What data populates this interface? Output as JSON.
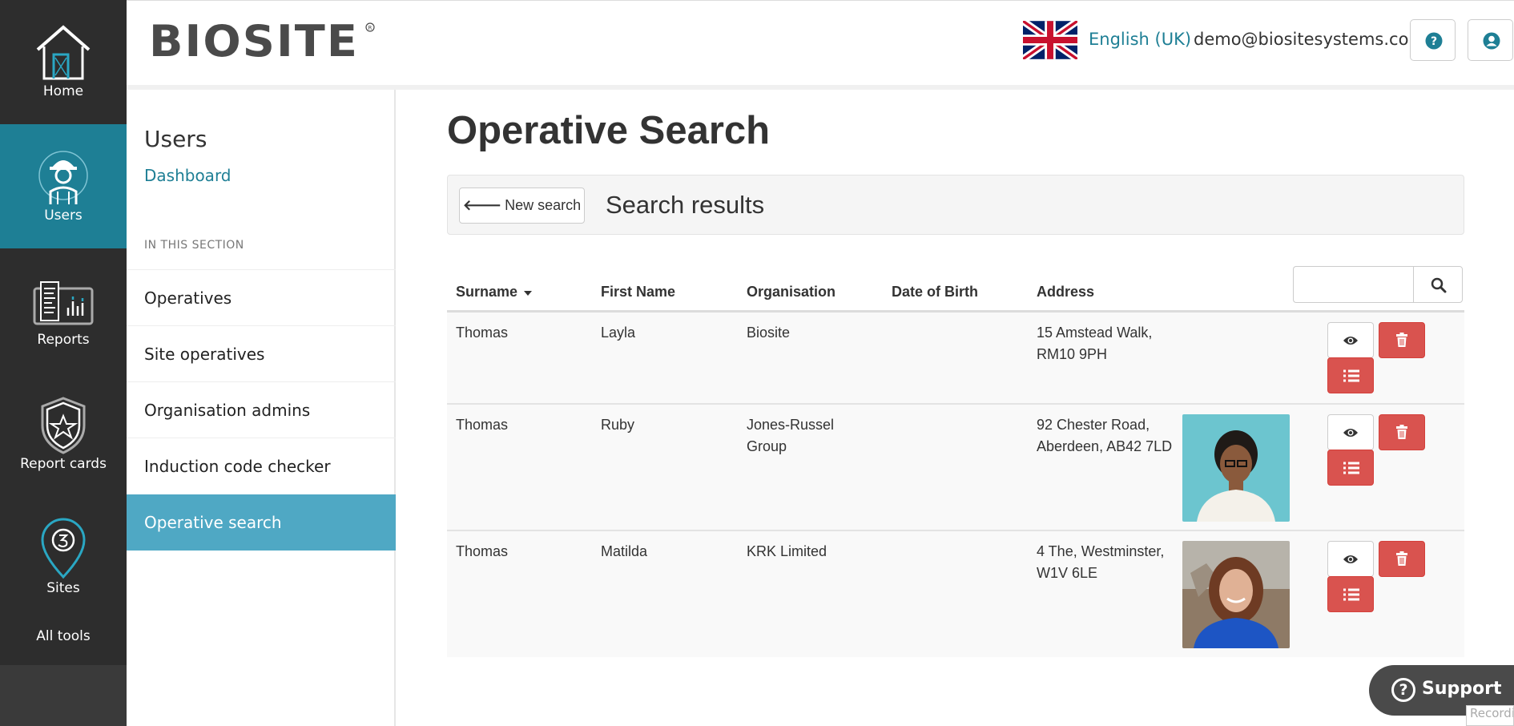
{
  "brand": {
    "logo_text": "BIOSITE",
    "accent": "#1e7f95",
    "danger": "#d9534f"
  },
  "leftnav": {
    "items": [
      {
        "label": "Home",
        "icon": "house-icon"
      },
      {
        "label": "Users",
        "icon": "worker-icon",
        "active": true
      },
      {
        "label": "Reports",
        "icon": "reports-icon"
      },
      {
        "label": "Report cards",
        "icon": "shield-star-icon"
      },
      {
        "label": "Sites",
        "icon": "map-pin-icon"
      }
    ],
    "all_tools": "All tools"
  },
  "header": {
    "language": "English (UK)",
    "language_flag": "uk-flag-icon",
    "user_email": "demo@biositesystems.com",
    "help_icon": "question-circle-icon",
    "account_icon": "user-circle-icon"
  },
  "subnav": {
    "title": "Users",
    "dashboard": "Dashboard",
    "section_label": "IN THIS SECTION",
    "items": [
      {
        "label": "Operatives"
      },
      {
        "label": "Site operatives"
      },
      {
        "label": "Organisation admins"
      },
      {
        "label": "Induction code checker"
      },
      {
        "label": "Operative search",
        "active": true
      }
    ]
  },
  "main": {
    "page_title": "Operative Search",
    "new_search": "New search",
    "results_heading": "Search results",
    "search": {
      "value": "",
      "placeholder": ""
    },
    "columns": [
      "Surname",
      "First Name",
      "Organisation",
      "Date of Birth",
      "Address"
    ],
    "sorted_column": "Surname",
    "rows": [
      {
        "surname": "Thomas",
        "first_name": "Layla",
        "organisation": "Biosite",
        "dob": "",
        "address": "15 Amstead Walk, RM10 9PH",
        "has_photo": false
      },
      {
        "surname": "Thomas",
        "first_name": "Ruby",
        "organisation": "Jones-Russel Group",
        "dob": "",
        "address": "92 Chester Road, Aberdeen, AB42 7LD",
        "has_photo": true
      },
      {
        "surname": "Thomas",
        "first_name": "Matilda",
        "organisation": "KRK Limited",
        "dob": "",
        "address": "4 The, Westminster, W1V 6LE",
        "has_photo": true
      }
    ]
  },
  "support": {
    "label": "Support"
  },
  "recording_badge": "Recording"
}
